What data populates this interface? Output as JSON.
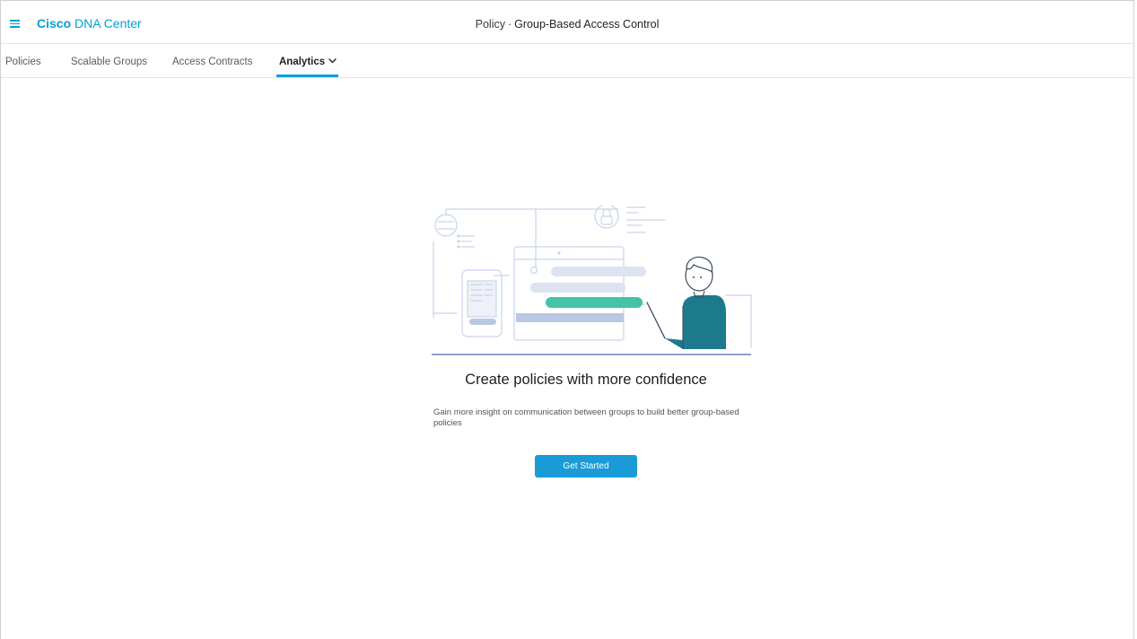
{
  "app": {
    "brand_strong": "Cisco",
    "brand_rest": " DNA Center",
    "title_prefix": "Policy",
    "title_separator": "·",
    "title_main": "Group-Based Access Control",
    "menu_icon": "hamburger-menu-icon"
  },
  "tabs": [
    {
      "label": "Policies",
      "active": false
    },
    {
      "label": "Scalable Groups",
      "active": false
    },
    {
      "label": "Access Contracts",
      "active": false
    },
    {
      "label": "Analytics",
      "active": true,
      "icon": "chevron-down-icon"
    }
  ],
  "empty_state": {
    "illustration": "person-pointing-at-policy-dashboard-illustration",
    "heading": "Create policies with more confidence",
    "description": "Gain more insight on communication between groups to build better group-based policies",
    "cta_label": "Get Started"
  },
  "colors": {
    "accent": "#049fd9",
    "button": "#1a9bd7",
    "illustration_line": "#c9d4e8",
    "illustration_bar": "#dde3f0",
    "illustration_highlight": "#46c3a7",
    "shirt": "#1d7a8c"
  }
}
